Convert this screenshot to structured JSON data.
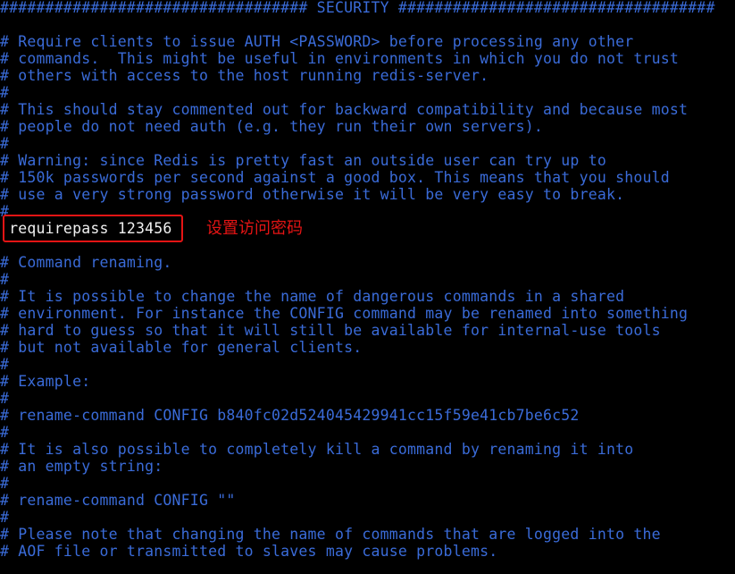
{
  "terminal": {
    "lines": [
      {
        "text": "################################## SECURITY ###################################",
        "kind": "comment"
      },
      {
        "text": "",
        "kind": "blank"
      },
      {
        "text": "# Require clients to issue AUTH <PASSWORD> before processing any other",
        "kind": "comment"
      },
      {
        "text": "# commands.  This might be useful in environments in which you do not trust",
        "kind": "comment"
      },
      {
        "text": "# others with access to the host running redis-server.",
        "kind": "comment"
      },
      {
        "text": "#",
        "kind": "comment"
      },
      {
        "text": "# This should stay commented out for backward compatibility and because most",
        "kind": "comment"
      },
      {
        "text": "# people do not need auth (e.g. they run their own servers).",
        "kind": "comment"
      },
      {
        "text": "#",
        "kind": "comment"
      },
      {
        "text": "# Warning: since Redis is pretty fast an outside user can try up to",
        "kind": "comment"
      },
      {
        "text": "# 150k passwords per second against a good box. This means that you should",
        "kind": "comment"
      },
      {
        "text": "# use a very strong password otherwise it will be very easy to break.",
        "kind": "comment"
      },
      {
        "text": "#",
        "kind": "comment"
      },
      {
        "text": " requirepass 123456",
        "kind": "active"
      },
      {
        "text": "",
        "kind": "blank"
      },
      {
        "text": "# Command renaming.",
        "kind": "comment"
      },
      {
        "text": "#",
        "kind": "comment"
      },
      {
        "text": "# It is possible to change the name of dangerous commands in a shared",
        "kind": "comment"
      },
      {
        "text": "# environment. For instance the CONFIG command may be renamed into something",
        "kind": "comment"
      },
      {
        "text": "# hard to guess so that it will still be available for internal-use tools",
        "kind": "comment"
      },
      {
        "text": "# but not available for general clients.",
        "kind": "comment"
      },
      {
        "text": "#",
        "kind": "comment"
      },
      {
        "text": "# Example:",
        "kind": "comment"
      },
      {
        "text": "#",
        "kind": "comment"
      },
      {
        "text": "# rename-command CONFIG b840fc02d524045429941cc15f59e41cb7be6c52",
        "kind": "comment"
      },
      {
        "text": "#",
        "kind": "comment"
      },
      {
        "text": "# It is also possible to completely kill a command by renaming it into",
        "kind": "comment"
      },
      {
        "text": "# an empty string:",
        "kind": "comment"
      },
      {
        "text": "#",
        "kind": "comment"
      },
      {
        "text": "# rename-command CONFIG \"\"",
        "kind": "comment"
      },
      {
        "text": "#",
        "kind": "comment"
      },
      {
        "text": "# Please note that changing the name of commands that are logged into the",
        "kind": "comment"
      },
      {
        "text": "# AOF file or transmitted to slaves may cause problems.",
        "kind": "comment"
      }
    ],
    "annotation": {
      "text": "设置访问密码"
    },
    "colors": {
      "background": "#000000",
      "comment": "#3a6bd8",
      "active": "#f0f0f0",
      "highlight": "#e51414"
    }
  }
}
